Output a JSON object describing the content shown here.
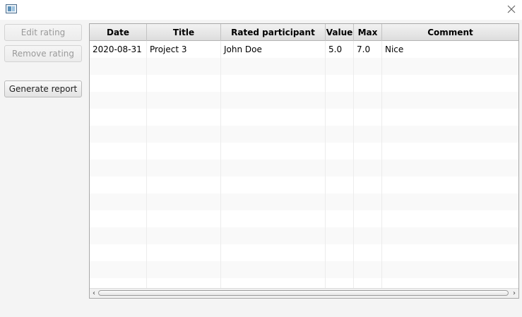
{
  "window": {
    "icon": "app-window-icon",
    "close_icon": "close-icon"
  },
  "sidebar": {
    "edit_label": "Edit rating",
    "remove_label": "Remove rating",
    "report_label": "Generate report"
  },
  "table": {
    "columns": [
      "Date",
      "Title",
      "Rated participant",
      "Value",
      "Max",
      "Comment"
    ],
    "rows": [
      {
        "date": "2020-08-31",
        "title": "Project 3",
        "participant": "John Doe",
        "value": "5.0",
        "max": "7.0",
        "comment": "Nice"
      }
    ]
  },
  "colors": {
    "header_bg": "#e6e6e6",
    "window_bg": "#f4f4f4",
    "row_alt": "#f9f9f9"
  }
}
